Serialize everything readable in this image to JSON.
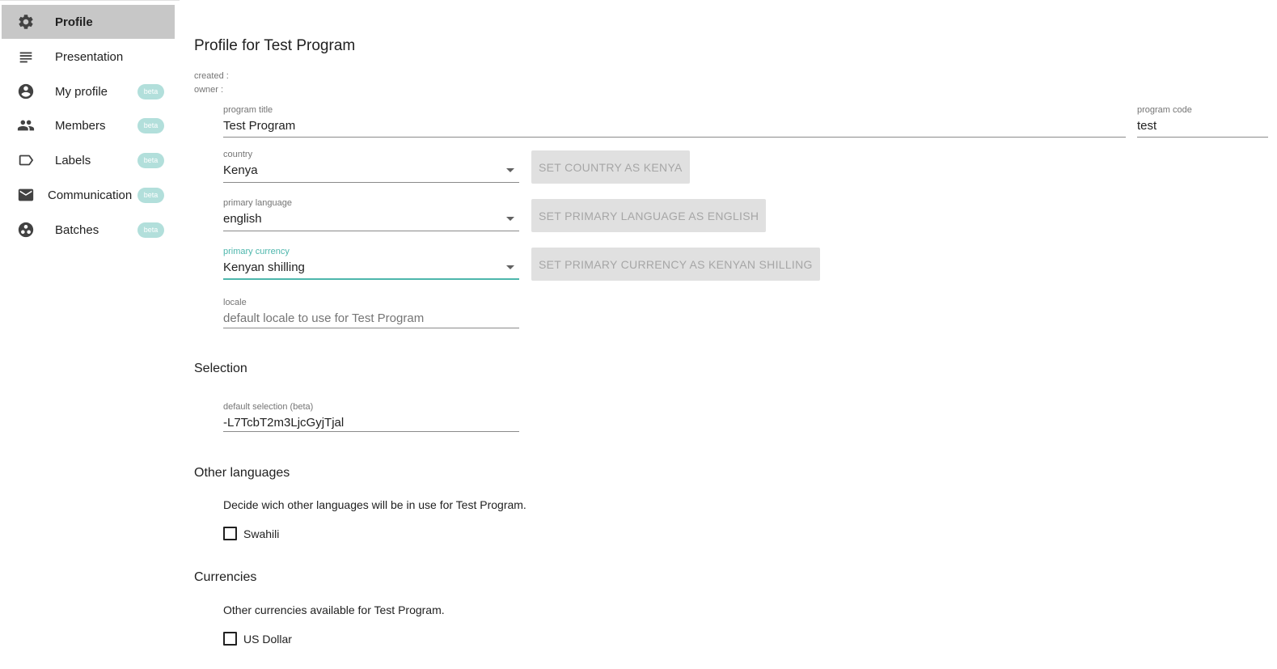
{
  "sidebar": {
    "items": [
      {
        "label": "Profile",
        "icon": "gear-icon",
        "active": true
      },
      {
        "label": "Presentation",
        "icon": "lines-icon"
      },
      {
        "label": "My profile",
        "icon": "account-circle-icon",
        "badge": "beta"
      },
      {
        "label": "Members",
        "icon": "people-icon",
        "badge": "beta"
      },
      {
        "label": "Labels",
        "icon": "label-icon",
        "badge": "beta"
      },
      {
        "label": "Communication",
        "icon": "mail-icon",
        "badge": "beta"
      },
      {
        "label": "Batches",
        "icon": "batches-icon",
        "badge": "beta"
      }
    ]
  },
  "profile": {
    "title": "Profile for Test Program",
    "created_label": "created :",
    "owner_label": "owner :",
    "program_title": {
      "label": "program title",
      "value": "Test Program"
    },
    "program_code": {
      "label": "program code",
      "value": "test"
    },
    "country": {
      "label": "country",
      "value": "Kenya",
      "button": "SET COUNTRY AS KENYA"
    },
    "primary_language": {
      "label": "primary language",
      "value": "english",
      "button": "SET PRIMARY LANGUAGE AS ENGLISH"
    },
    "primary_currency": {
      "label": "primary currency",
      "value": "Kenyan shilling",
      "button": "SET PRIMARY CURRENCY AS KENYAN SHILLING"
    },
    "locale": {
      "label": "locale",
      "placeholder": "default locale to use for Test Program"
    }
  },
  "selection": {
    "title": "Selection",
    "default_selection": {
      "label": "default selection (beta)",
      "value": "-L7TcbT2m3LjcGyjTjal"
    }
  },
  "other_languages": {
    "title": "Other languages",
    "description": "Decide wich other languages will be in use for Test Program.",
    "options": [
      {
        "label": "Swahili",
        "checked": false
      }
    ]
  },
  "currencies": {
    "title": "Currencies",
    "description": "Other currencies available for Test Program.",
    "options": [
      {
        "label": "US Dollar",
        "checked": false
      }
    ]
  },
  "colors": {
    "accent": "#4db6ac",
    "badge": "#b2dfdb",
    "active_nav": "#c7c7c7",
    "button_bg": "#e0e0e0"
  }
}
